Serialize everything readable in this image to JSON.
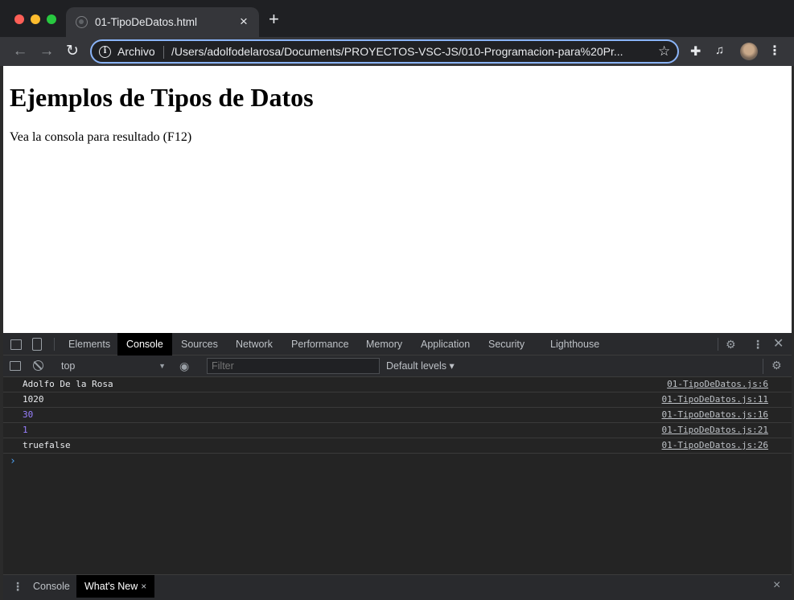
{
  "tab": {
    "title": "01-TipoDeDatos.html",
    "close": "×",
    "new_tab": "+"
  },
  "toolbar": {
    "back": "←",
    "forward": "→",
    "reload": "↻",
    "scheme_label": "Archivo",
    "url": "/Users/adolfodelarosa/Documents/PROYECTOS-VSC-JS/010-Programacion-para%20Pr...",
    "focus_color": "#8ab4f8"
  },
  "page": {
    "heading": "Ejemplos de Tipos de Datos",
    "paragraph": "Vea la consola para resultado (F12)"
  },
  "devtools": {
    "tabs": [
      "Elements",
      "Console",
      "Sources",
      "Network",
      "Performance",
      "Memory",
      "Application",
      "Security",
      "Lighthouse"
    ],
    "active_tab": "Console",
    "context": "top",
    "filter_placeholder": "Filter",
    "levels": "Default levels ▾",
    "logs": [
      {
        "message": "Adolfo De la Rosa",
        "source": "01-TipoDeDatos.js:6",
        "kind": "string"
      },
      {
        "message": "1020",
        "source": "01-TipoDeDatos.js:11",
        "kind": "string"
      },
      {
        "message": "30",
        "source": "01-TipoDeDatos.js:16",
        "kind": "number"
      },
      {
        "message": "1",
        "source": "01-TipoDeDatos.js:21",
        "kind": "number"
      },
      {
        "message": "truefalse",
        "source": "01-TipoDeDatos.js:26",
        "kind": "string"
      }
    ],
    "prompt": "›",
    "number_color": "#9980ff",
    "drawer": {
      "tabs": [
        "Console",
        "What's New"
      ],
      "active_tab": "What's New",
      "close": "×"
    }
  }
}
